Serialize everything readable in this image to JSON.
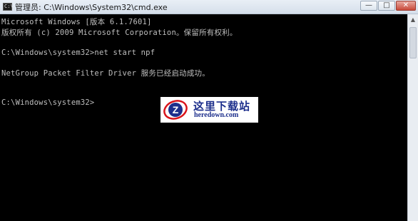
{
  "window": {
    "title": "管理员: C:\\Windows\\System32\\cmd.exe",
    "icon": "cmd-icon",
    "icon_label": "C:\\",
    "buttons": {
      "minimize": "—",
      "maximize": "□",
      "close": "✕"
    }
  },
  "console": {
    "lines": [
      "Microsoft Windows [版本 6.1.7601]",
      "版权所有 (c) 2009 Microsoft Corporation。保留所有权利。",
      "C:\\Windows\\system32>net start npf",
      "NetGroup Packet Filter Driver 服务已经启动成功。",
      "C:\\Windows\\system32>"
    ]
  },
  "scrollbar": {
    "up_arrow": "▲"
  },
  "watermark": {
    "text_cn": "这里下载站",
    "text_en": "heredown.com",
    "logo_letter": "Z",
    "colors": {
      "blue": "#1d2f8c",
      "red": "#d9141b"
    }
  }
}
